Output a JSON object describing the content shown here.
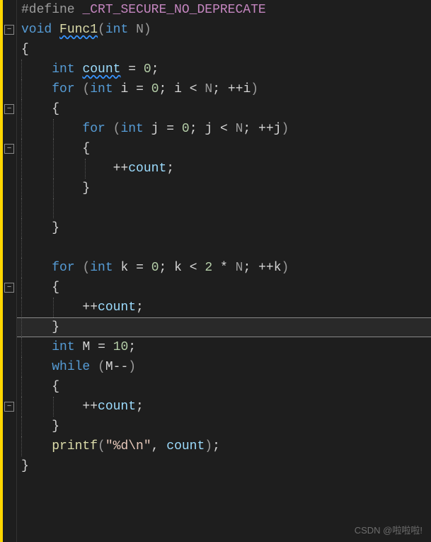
{
  "code": {
    "l1": {
      "pp": "#define",
      "sp": " ",
      "mac": "_CRT_SECURE_NO_DEPRECATE"
    },
    "l2": {
      "kw": "void",
      "sp": " ",
      "fn": "Func1",
      "lp": "(",
      "t": "int",
      "sp2": " ",
      "p": "N",
      "rp": ")"
    },
    "l3": {
      "br": "{"
    },
    "l4": {
      "t": "int",
      "sp": " ",
      "v": "count",
      "sp2": " ",
      "eq": "=",
      "sp3": " ",
      "n": "0",
      "sc": ";"
    },
    "l5": {
      "kw": "for",
      "sp": " ",
      "lp": "(",
      "t": "int",
      "sp2": " ",
      "v": "i",
      "sp3": " ",
      "eq": "=",
      "sp4": " ",
      "n": "0",
      "sc": ";",
      "sp5": " ",
      "v2": "i",
      "sp6": " ",
      "lt": "<",
      "sp7": " ",
      "N": "N",
      "sc2": ";",
      "sp8": " ",
      "inc": "++",
      "v3": "i",
      "rp": ")"
    },
    "l6": {
      "br": "{"
    },
    "l7": {
      "kw": "for",
      "sp": " ",
      "lp": "(",
      "t": "int",
      "sp2": " ",
      "v": "j",
      "sp3": " ",
      "eq": "=",
      "sp4": " ",
      "n": "0",
      "sc": ";",
      "sp5": " ",
      "v2": "j",
      "sp6": " ",
      "lt": "<",
      "sp7": " ",
      "N": "N",
      "sc2": ";",
      "sp8": " ",
      "inc": "++",
      "v3": "j",
      "rp": ")"
    },
    "l8": {
      "br": "{"
    },
    "l9": {
      "inc": "++",
      "v": "count",
      "sc": ";"
    },
    "l10": {
      "br": "}"
    },
    "l11": {
      "br": "}"
    },
    "l12": {
      "kw": "for",
      "sp": " ",
      "lp": "(",
      "t": "int",
      "sp2": " ",
      "v": "k",
      "sp3": " ",
      "eq": "=",
      "sp4": " ",
      "n": "0",
      "sc": ";",
      "sp5": " ",
      "v2": "k",
      "sp6": " ",
      "lt": "<",
      "sp7": " ",
      "n2": "2",
      "sp8": " ",
      "mul": "*",
      "sp9": " ",
      "N": "N",
      "sc2": ";",
      "sp10": " ",
      "inc": "++",
      "v3": "k",
      "rp": ")"
    },
    "l13": {
      "br": "{"
    },
    "l14": {
      "inc": "++",
      "v": "count",
      "sc": ";"
    },
    "l15": {
      "br": "}"
    },
    "l16": {
      "t": "int",
      "sp": " ",
      "v": "M",
      "sp2": " ",
      "eq": "=",
      "sp3": " ",
      "n": "10",
      "sc": ";"
    },
    "l17": {
      "kw": "while",
      "sp": " ",
      "lp": "(",
      "v": "M",
      "dec": "--",
      "rp": ")"
    },
    "l18": {
      "br": "{"
    },
    "l19": {
      "inc": "++",
      "v": "count",
      "sc": ";"
    },
    "l20": {
      "br": "}"
    },
    "l21": {
      "fn": "printf",
      "lp": "(",
      "s": "\"%d\\n\"",
      "cm": ",",
      "sp": " ",
      "v": "count",
      "rp": ")",
      "sc": ";"
    },
    "l22": {
      "br": "}"
    }
  },
  "fold_glyph": "−",
  "watermark": "CSDN @啦啦啦!"
}
